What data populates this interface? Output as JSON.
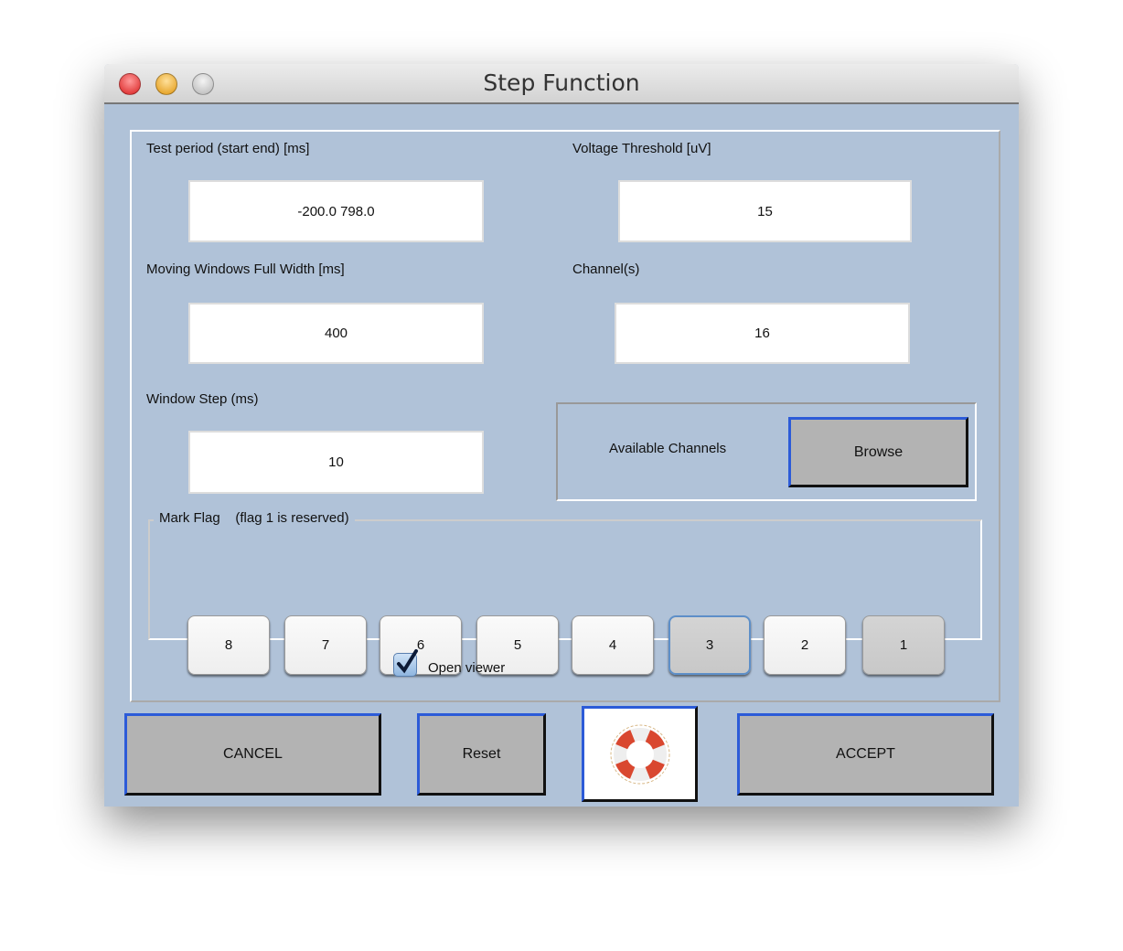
{
  "window": {
    "title": "Step Function"
  },
  "fields": {
    "test_period": {
      "label": "Test period (start end) [ms]",
      "value": "-200.0  798.0"
    },
    "voltage_threshold": {
      "label": "Voltage Threshold [uV]",
      "value": "15"
    },
    "moving_window": {
      "label": "Moving Windows Full Width [ms]",
      "value": "400"
    },
    "channels": {
      "label": "Channel(s)",
      "value": "16"
    },
    "window_step": {
      "label": "Window Step (ms)",
      "value": "10"
    }
  },
  "available_channels": {
    "label": "Available Channels",
    "browse_label": "Browse"
  },
  "mark_flag": {
    "label": "Mark Flag",
    "note": "(flag 1 is reserved)",
    "flags": [
      {
        "label": "8",
        "selected": false
      },
      {
        "label": "7",
        "selected": false
      },
      {
        "label": "6",
        "selected": false
      },
      {
        "label": "5",
        "selected": false
      },
      {
        "label": "4",
        "selected": false
      },
      {
        "label": "3",
        "selected": true
      },
      {
        "label": "2",
        "selected": false
      },
      {
        "label": "1",
        "selected": true
      }
    ]
  },
  "open_viewer": {
    "label": "Open viewer",
    "checked": true
  },
  "buttons": {
    "cancel": "CANCEL",
    "reset": "Reset",
    "help_icon": "lifebuoy-icon",
    "accept": "ACCEPT"
  },
  "colors": {
    "background": "#b0c2d8",
    "button": "#b3b3b3",
    "focus": "#2c5bd8"
  }
}
